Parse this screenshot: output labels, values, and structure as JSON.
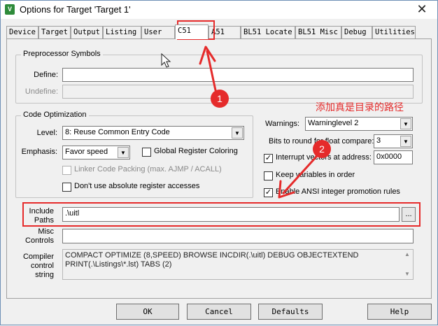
{
  "window": {
    "title": "Options for Target 'Target 1'",
    "close_glyph": "✕",
    "icon_glyph": "V"
  },
  "tabs": [
    {
      "label": "Device"
    },
    {
      "label": "Target"
    },
    {
      "label": "Output"
    },
    {
      "label": "Listing"
    },
    {
      "label": "User"
    },
    {
      "label": "C51"
    },
    {
      "label": "A51"
    },
    {
      "label": "BL51 Locate"
    },
    {
      "label": "BL51 Misc"
    },
    {
      "label": "Debug"
    },
    {
      "label": "Utilities"
    }
  ],
  "active_tab": "C51",
  "preprocessor": {
    "title": "Preprocessor Symbols",
    "define_label": "Define:",
    "define_value": "",
    "undefine_label": "Undefine:",
    "undefine_value": ""
  },
  "code_optimization": {
    "title": "Code Optimization",
    "level_label": "Level:",
    "level_value": "8: Reuse Common Entry Code",
    "emphasis_label": "Emphasis:",
    "emphasis_value": "Favor speed",
    "global_register_coloring": {
      "label": "Global Register Coloring",
      "checked": false
    },
    "linker_code_packing": {
      "label": "Linker Code Packing (max. AJMP / ACALL)",
      "checked": false,
      "enabled": false
    },
    "no_absolute_register": {
      "label": "Don't use absolute register accesses",
      "checked": false
    }
  },
  "right_options": {
    "warnings_label": "Warnings:",
    "warnings_value": "Warninglevel 2",
    "bits_round_label": "Bits to round for float compare:",
    "bits_round_value": "3",
    "interrupt_vectors": {
      "label": "Interrupt vectors at address:",
      "checked": true,
      "value": "0x0000"
    },
    "keep_variables": {
      "label": "Keep variables in order",
      "checked": false
    },
    "ansi_promotion": {
      "label": "Enable ANSI integer promotion rules",
      "checked": true
    }
  },
  "include_paths": {
    "label_line1": "Include",
    "label_line2": "Paths",
    "value": ".\\uitl",
    "browse_label": "..."
  },
  "misc_controls": {
    "label_line1": "Misc",
    "label_line2": "Controls",
    "value": ""
  },
  "compiler_control": {
    "label_line1": "Compiler",
    "label_line2": "control",
    "label_line3": "string",
    "value": "COMPACT OPTIMIZE (8,SPEED) BROWSE INCDIR(.\\uitl) DEBUG OBJECTEXTEND PRINT(.\\Listings\\*.lst) TABS (2)"
  },
  "buttons": {
    "ok": "OK",
    "cancel": "Cancel",
    "defaults": "Defaults",
    "help": "Help"
  },
  "annotations": {
    "badge1": "1",
    "badge2": "2",
    "note": "添加真是目录的路径",
    "color": "#e52b2b"
  }
}
